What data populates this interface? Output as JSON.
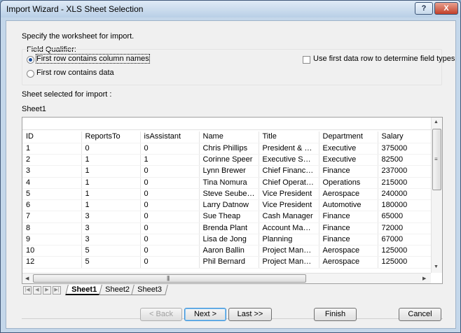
{
  "window": {
    "title": "Import Wizard - XLS Sheet Selection",
    "help_label": "?",
    "close_label": "X"
  },
  "instructions": "Specify the worksheet for import.",
  "field_qualifier": {
    "label": "Field Qualifier:",
    "options": [
      {
        "label": "First row contains column names",
        "selected": true
      },
      {
        "label": "First row contains data",
        "selected": false
      }
    ],
    "checkbox_label": "Use first data row to determine field types",
    "checkbox_checked": false
  },
  "sheet_selected_label": "Sheet selected for import :",
  "sheet_selected_value": "Sheet1",
  "grid": {
    "columns": [
      "ID",
      "ReportsTo",
      "isAssistant",
      "Name",
      "Title",
      "Department",
      "Salary"
    ],
    "rows": [
      [
        "1",
        "0",
        "0",
        "Chris Phillips",
        "President & CEO",
        "Executive",
        "375000"
      ],
      [
        "2",
        "1",
        "1",
        "Corinne Speer",
        "Executive Secr...",
        "Executive",
        "82500"
      ],
      [
        "3",
        "1",
        "0",
        "Lynn Brewer",
        "Chief Financial...",
        "Finance",
        "237000"
      ],
      [
        "4",
        "1",
        "0",
        "Tina Nomura",
        "Chief Operatio...",
        "Operations",
        "215000"
      ],
      [
        "5",
        "1",
        "0",
        "Steve Seuberling",
        "Vice President",
        "Aerospace",
        "240000"
      ],
      [
        "6",
        "1",
        "0",
        "Larry Datnow",
        "Vice President",
        "Automotive",
        "180000"
      ],
      [
        "7",
        "3",
        "0",
        "Sue Theap",
        "Cash Manager",
        "Finance",
        "65000"
      ],
      [
        "8",
        "3",
        "0",
        "Brenda Plant",
        "Account Mana...",
        "Finance",
        "72000"
      ],
      [
        "9",
        "3",
        "0",
        "Lisa de Jong",
        "Planning",
        "Finance",
        "67000"
      ],
      [
        "10",
        "5",
        "0",
        "Aaron Ballin",
        "Project Manager",
        "Aerospace",
        "125000"
      ],
      [
        "12",
        "5",
        "0",
        "Phil Bernard",
        "Project Manager",
        "Aerospace",
        "125000"
      ]
    ]
  },
  "sheet_tabs": [
    "Sheet1",
    "Sheet2",
    "Sheet3"
  ],
  "active_sheet": "Sheet1",
  "buttons": {
    "back": "< Back",
    "next": "Next >",
    "last": "Last >>",
    "finish": "Finish",
    "cancel": "Cancel"
  },
  "colors": {
    "titlebar": "#c4d7ea",
    "close_button": "#c2402a",
    "dialog_bg": "#f0f0f0"
  }
}
